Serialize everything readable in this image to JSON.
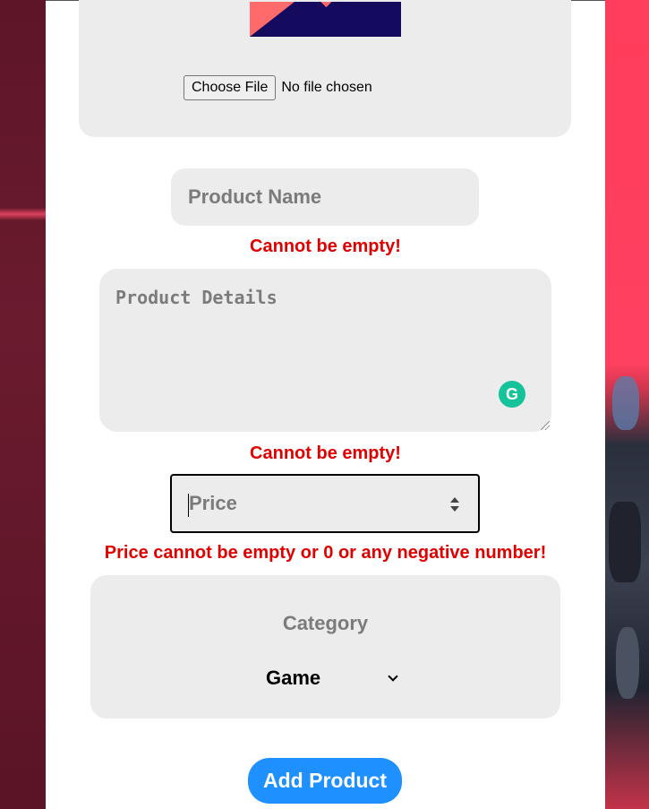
{
  "upload": {
    "button_label": "Choose File",
    "status": "No file chosen"
  },
  "product_name": {
    "placeholder": "Product Name",
    "error": "Cannot be empty!"
  },
  "product_details": {
    "placeholder": "Product Details",
    "error": "Cannot be empty!",
    "grammarly_glyph": "G"
  },
  "price": {
    "placeholder": "Price",
    "error": "Price cannot be empty or 0 or any negative number!"
  },
  "category": {
    "label": "Category",
    "selected": "Game"
  },
  "submit": {
    "label": "Add Product"
  },
  "colors": {
    "error": "#e00000",
    "accent": "#1e90ff",
    "field_bg": "#ececec"
  }
}
